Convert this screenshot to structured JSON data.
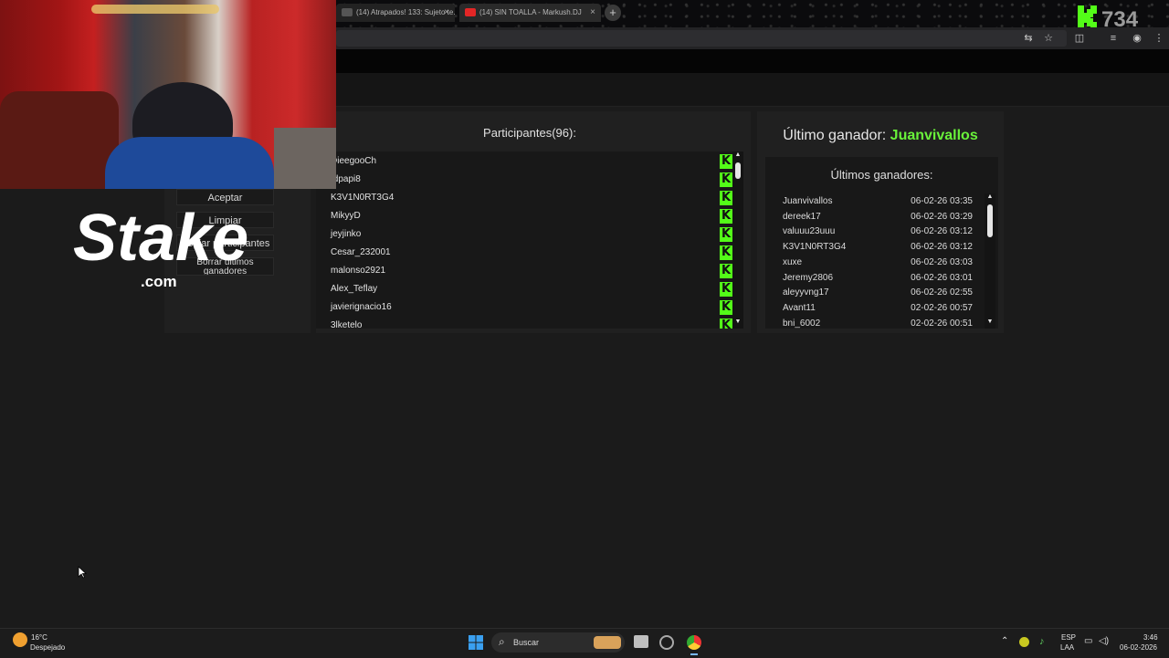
{
  "browser": {
    "tabs": [
      {
        "label": "(14) Atrapados! 133: Sujeto te...",
        "close": "×"
      },
      {
        "label": "(14) SIN TOALLA - Markush.DJ",
        "close": "×"
      }
    ],
    "new_tab": "+",
    "brand_logo_text": "K·734"
  },
  "left_panel": {
    "buttons": [
      "Aceptar",
      "Limpiar",
      "Copiar participantes",
      "Borrar últimos ganadores"
    ]
  },
  "participants": {
    "title": "Participantes(96):",
    "badge": "K",
    "items": [
      "DieegooCh",
      "Idpapi8",
      "K3V1N0RT3G4",
      "MikyyD",
      "jeyjinko",
      "Cesar_232001",
      "malonso2921",
      "Alex_Teflay",
      "javierignacio16",
      "3lketelo"
    ]
  },
  "winners": {
    "last_winner_label": "Último ganador:",
    "last_winner_name": "Juanvivallos",
    "list_title": "Últimos ganadores:",
    "items": [
      {
        "name": "Juanvivallos",
        "date": "06-02-26 03:35"
      },
      {
        "name": "dereek17",
        "date": "06-02-26 03:29"
      },
      {
        "name": "valuuu23uuu",
        "date": "06-02-26 03:12"
      },
      {
        "name": "K3V1N0RT3G4",
        "date": "06-02-26 03:12"
      },
      {
        "name": "xuxe",
        "date": "06-02-26 03:03"
      },
      {
        "name": "Jeremy2806",
        "date": "06-02-26 03:01"
      },
      {
        "name": "aleyyvng17",
        "date": "06-02-26 02:55"
      },
      {
        "name": "Avant11",
        "date": "02-02-26 00:57"
      },
      {
        "name": "bni_6002",
        "date": "02-02-26 00:51"
      }
    ]
  },
  "overlay": {
    "stake_logo": "Stake",
    "stake_domain": ".com"
  },
  "taskbar": {
    "weather_temp": "16°C",
    "weather_desc": "Despejado",
    "search_placeholder": "Buscar",
    "lang_line1": "ESP",
    "lang_line2": "LAA",
    "time": "3:46",
    "date": "06-02-2026"
  },
  "colors": {
    "kick_green": "#53fc18",
    "winner_green": "#69f23a",
    "page_bg": "#1b1b1b"
  }
}
